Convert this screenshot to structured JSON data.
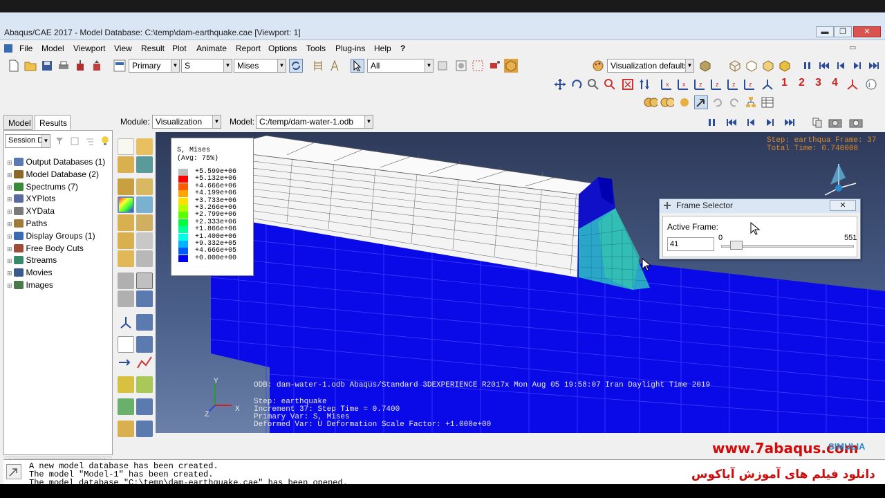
{
  "window": {
    "title": "Abaqus/CAE 2017 - Model Database: C:\\temp\\dam-earthquake.cae [Viewport: 1]",
    "minimize": "▬",
    "maximize": "❐",
    "close": "✕"
  },
  "menu": {
    "items": [
      "File",
      "Model",
      "Viewport",
      "View",
      "Result",
      "Plot",
      "Animate",
      "Report",
      "Options",
      "Tools",
      "Plug-ins",
      "Help",
      "?"
    ]
  },
  "toolbar": {
    "primary": "Primary",
    "variable": "S",
    "invariant": "Mises",
    "selection": "All",
    "visualization_defaults": "Visualization defaults",
    "digits": [
      "1",
      "2",
      "3",
      "4"
    ]
  },
  "context": {
    "module_label": "Module:",
    "module_value": "Visualization",
    "model_label": "Model:",
    "model_value": "C:/temp/dam-water-1.odb"
  },
  "panel": {
    "tabs": [
      "Model",
      "Results"
    ],
    "session_data": "Session Data",
    "tree": [
      {
        "label": "Output Databases (1)",
        "color": "#5a7ab0"
      },
      {
        "label": "Model Database (2)",
        "color": "#8a6a2a"
      },
      {
        "label": "Spectrums (7)",
        "color": "#3a8a3a"
      },
      {
        "label": "XYPlots",
        "color": "#5a6aa0"
      },
      {
        "label": "XYData",
        "color": "#7a7a7a"
      },
      {
        "label": "Paths",
        "color": "#a07a3a"
      },
      {
        "label": "Display Groups (1)",
        "color": "#3a6ab0"
      },
      {
        "label": "Free Body Cuts",
        "color": "#a04a3a"
      },
      {
        "label": "Streams",
        "color": "#3a8a6a"
      },
      {
        "label": "Movies",
        "color": "#3a5a8a"
      },
      {
        "label": "Images",
        "color": "#4a7a4a"
      }
    ]
  },
  "legend": {
    "title": "S, Mises",
    "subtitle": "(Avg: 75%)",
    "entries": [
      {
        "value": "+5.599e+06",
        "color": "#bdbdbd"
      },
      {
        "value": "+5.132e+06",
        "color": "#ff0000"
      },
      {
        "value": "+4.666e+06",
        "color": "#ff5a00"
      },
      {
        "value": "+4.199e+06",
        "color": "#ffa500"
      },
      {
        "value": "+3.733e+06",
        "color": "#ffe000"
      },
      {
        "value": "+3.266e+06",
        "color": "#b4ff00"
      },
      {
        "value": "+2.799e+06",
        "color": "#5aff00"
      },
      {
        "value": "+2.333e+06",
        "color": "#00ff3a"
      },
      {
        "value": "+1.866e+06",
        "color": "#00ff9a"
      },
      {
        "value": "+1.400e+06",
        "color": "#00ffe6"
      },
      {
        "value": "+9.332e+05",
        "color": "#00b4ff"
      },
      {
        "value": "+4.666e+05",
        "color": "#0058ff"
      },
      {
        "value": "+0.000e+00",
        "color": "#0000ff"
      }
    ]
  },
  "viewport": {
    "step_line": "Step: earthqua Frame: 37",
    "time_line": "Total Time: 0.740000",
    "odb_line": "ODB: dam-water-1.odb    Abaqus/Standard 3DEXPERIENCE R2017x   Mon Aug 05 19:58:07 Iran Daylight Time 2019",
    "info": [
      "Step: earthquake",
      "Increment     37: Step Time =    0.7400",
      "Primary Var: S, Mises",
      "Deformed Var: U   Deformation Scale Factor: +1.000e+00"
    ],
    "axis_y": "Y",
    "axis_x": "X",
    "axis_z": "Z"
  },
  "frame_selector": {
    "title": "Frame Selector",
    "active_label": "Active Frame:",
    "value": "41",
    "min": "0",
    "max": "551",
    "slider_fraction": 0.074
  },
  "messages": [
    "A new model database has been created.",
    "The model \"Model-1\" has been created.",
    "The model database \"C:\\temp\\dam-earthquake.cae\" has been opened."
  ],
  "watermark": {
    "url": "www.7abaqus.com",
    "persian": "دانلود فیلم های آموزش آباکوس",
    "simulia": "SIMULIA"
  }
}
